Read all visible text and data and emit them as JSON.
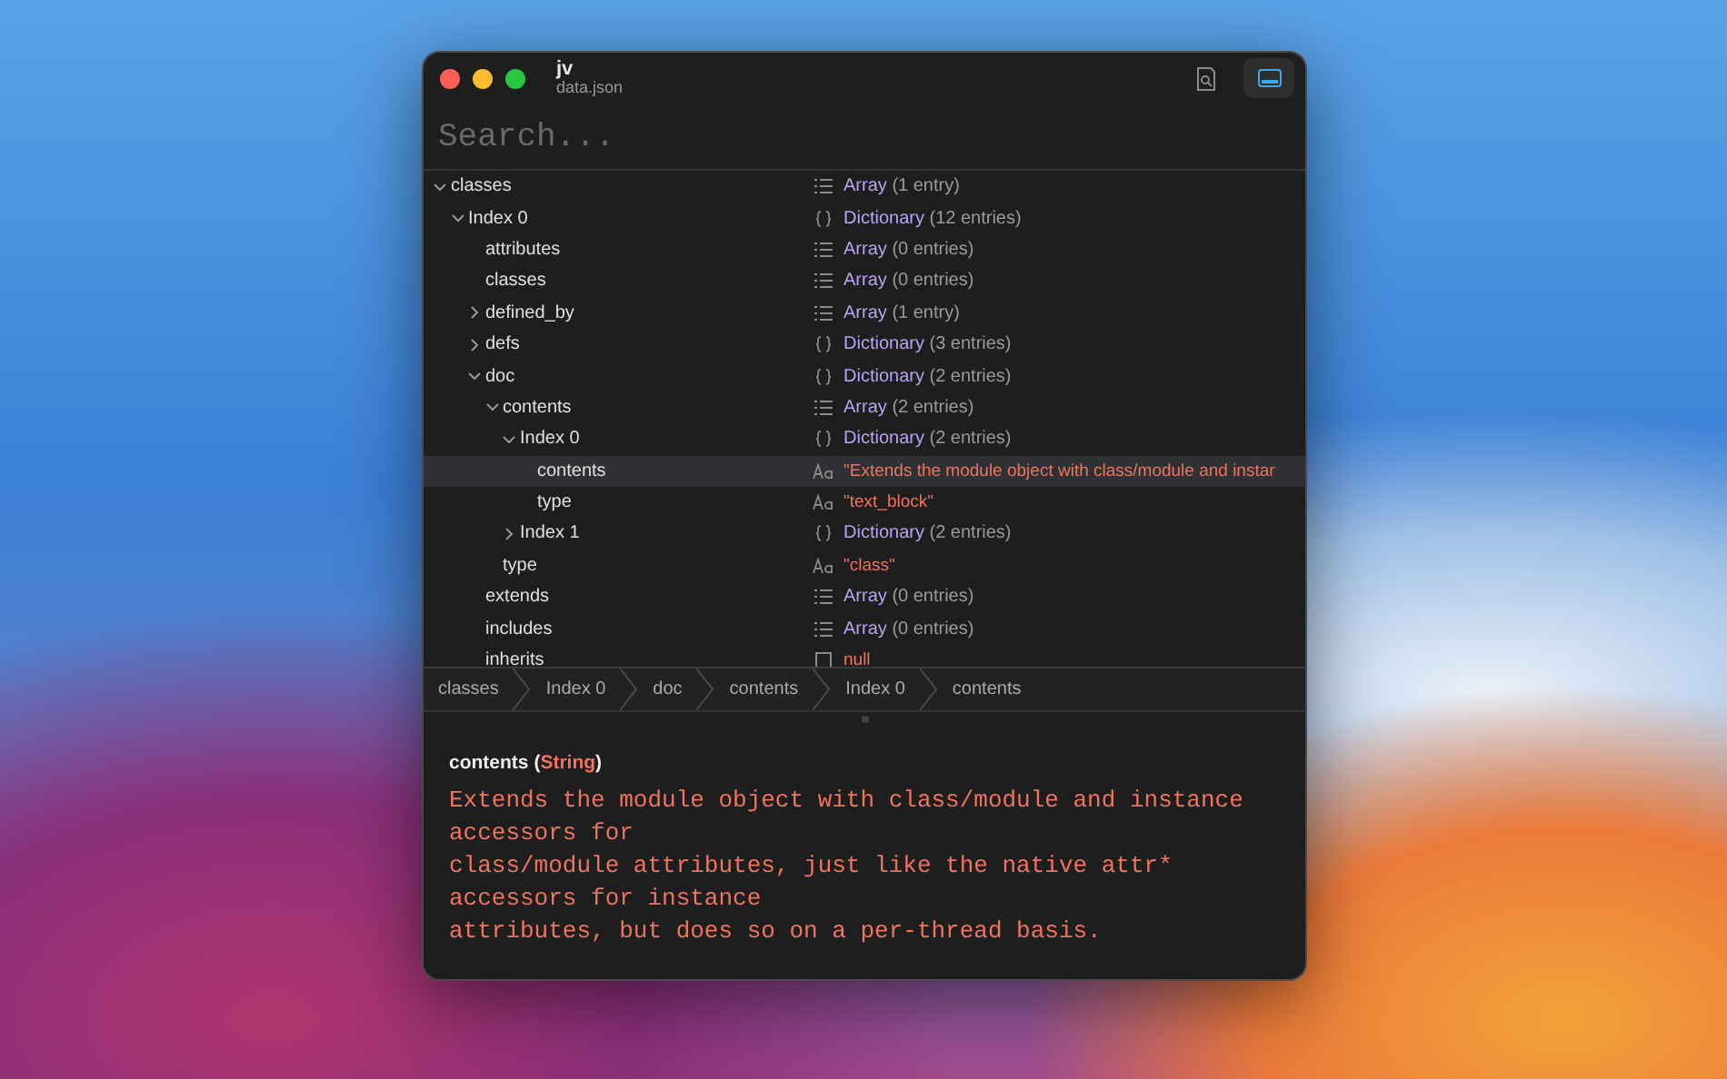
{
  "window": {
    "title": "jv",
    "subtitle": "data.json"
  },
  "toolbar": [
    {
      "kind": "inspector",
      "selected": false
    },
    {
      "kind": "panel",
      "selected": true
    }
  ],
  "search": {
    "placeholder": "Search..."
  },
  "tree": [
    {
      "key": "classes",
      "expanded": true,
      "selected": false,
      "value": {
        "kind": "array",
        "type": "Array",
        "summary": "(1 entry)"
      },
      "children": [
        {
          "key": "Index 0",
          "expanded": true,
          "selected": false,
          "value": {
            "kind": "dict",
            "type": "Dictionary",
            "summary": "(12 entries)"
          },
          "children": [
            {
              "key": "attributes",
              "selected": false,
              "value": {
                "kind": "array",
                "type": "Array",
                "summary": "(0 entries)"
              }
            },
            {
              "key": "classes",
              "selected": false,
              "value": {
                "kind": "array",
                "type": "Array",
                "summary": "(0 entries)"
              }
            },
            {
              "key": "defined_by",
              "expanded": false,
              "selected": false,
              "value": {
                "kind": "array",
                "type": "Array",
                "summary": "(1 entry)"
              }
            },
            {
              "key": "defs",
              "expanded": false,
              "selected": false,
              "value": {
                "kind": "dict",
                "type": "Dictionary",
                "summary": "(3 entries)"
              }
            },
            {
              "key": "doc",
              "expanded": true,
              "selected": false,
              "value": {
                "kind": "dict",
                "type": "Dictionary",
                "summary": "(2 entries)"
              },
              "children": [
                {
                  "key": "contents",
                  "expanded": true,
                  "selected": false,
                  "value": {
                    "kind": "array",
                    "type": "Array",
                    "summary": "(2 entries)"
                  },
                  "children": [
                    {
                      "key": "Index 0",
                      "expanded": true,
                      "selected": false,
                      "value": {
                        "kind": "dict",
                        "type": "Dictionary",
                        "summary": "(2 entries)"
                      },
                      "children": [
                        {
                          "key": "contents",
                          "selected": true,
                          "value": {
                            "kind": "string",
                            "text": "\"Extends the module object with class/module and instar"
                          }
                        },
                        {
                          "key": "type",
                          "selected": false,
                          "value": {
                            "kind": "string",
                            "text": "\"text_block\""
                          }
                        }
                      ]
                    },
                    {
                      "key": "Index 1",
                      "expanded": false,
                      "selected": false,
                      "value": {
                        "kind": "dict",
                        "type": "Dictionary",
                        "summary": "(2 entries)"
                      }
                    }
                  ]
                },
                {
                  "key": "type",
                  "selected": false,
                  "value": {
                    "kind": "string",
                    "text": "\"class\""
                  }
                }
              ]
            },
            {
              "key": "extends",
              "selected": false,
              "value": {
                "kind": "array",
                "type": "Array",
                "summary": "(0 entries)"
              }
            },
            {
              "key": "includes",
              "selected": false,
              "value": {
                "kind": "array",
                "type": "Array",
                "summary": "(0 entries)"
              }
            },
            {
              "key": "inherits",
              "selected": false,
              "value": {
                "kind": "null",
                "text": "null"
              }
            }
          ]
        }
      ]
    }
  ],
  "breadcrumbs": [
    "classes",
    "Index 0",
    "doc",
    "contents",
    "Index 0",
    "contents"
  ],
  "detail": {
    "key": "contents",
    "paren_open": "(",
    "type": "String",
    "paren_close": ")",
    "text": "Extends the module object with class/module and instance accessors for\nclass/module attributes, just like the native attr* accessors for instance\nattributes, but does so on a per-thread basis."
  }
}
